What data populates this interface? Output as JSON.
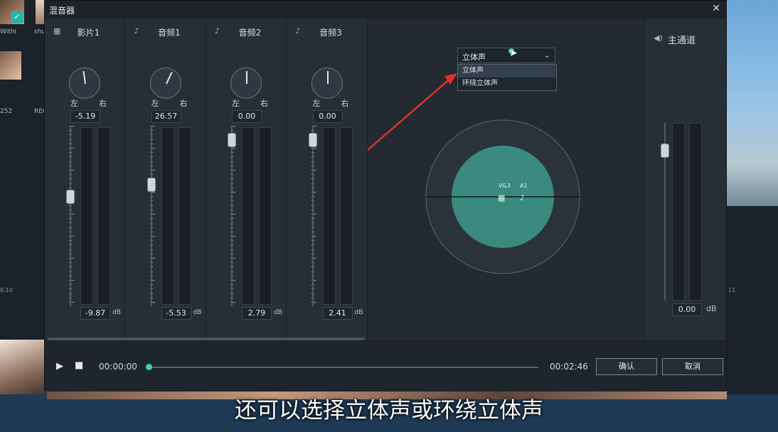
{
  "background": {
    "label_top1": "Withi",
    "label_top2": "shu",
    "label_mid1": "252",
    "label_mid2": "REC",
    "ruler_left": "8:10",
    "ruler_right": "11"
  },
  "window": {
    "title": "混音器",
    "close_icon": "close-icon"
  },
  "channels": [
    {
      "icon": "film-icon",
      "name": "影片1",
      "left": "左",
      "right": "右",
      "pan": "-5.19",
      "db": "-9.87",
      "unit": "dB",
      "fader_level": 0.32,
      "pan_angle": -8
    },
    {
      "icon": "music-note-icon",
      "name": "音频1",
      "left": "左",
      "right": "右",
      "pan": "26.57",
      "db": "-5.53",
      "unit": "dB",
      "fader_level": 0.25,
      "pan_angle": 25
    },
    {
      "icon": "music-note-icon",
      "name": "音频2",
      "left": "左",
      "right": "右",
      "pan": "0.00",
      "db": "2.79",
      "unit": "dB",
      "fader_level": 0.0,
      "pan_angle": 0
    },
    {
      "icon": "music-note-icon",
      "name": "音频3",
      "left": "左",
      "right": "右",
      "pan": "0.00",
      "db": "2.41",
      "unit": "dB",
      "fader_level": 0.0,
      "pan_angle": 0
    }
  ],
  "mode": {
    "selected": "立体声",
    "options": [
      "立体声",
      "环绕立体声"
    ]
  },
  "sound_field": {
    "label_v": "V&3",
    "label_a": "A1"
  },
  "master": {
    "icon": "speaker-icon",
    "name": "主通道",
    "db": "0.00",
    "unit": "dB"
  },
  "transport": {
    "current_time": "00:00:00",
    "total_time": "00:02:46",
    "confirm": "确认",
    "cancel": "取消"
  },
  "subtitle": "还可以选择立体声或环绕立体声",
  "colors": {
    "accent": "#3fd0bd",
    "field": "#3a8b7e",
    "arrow": "#e0322d"
  }
}
